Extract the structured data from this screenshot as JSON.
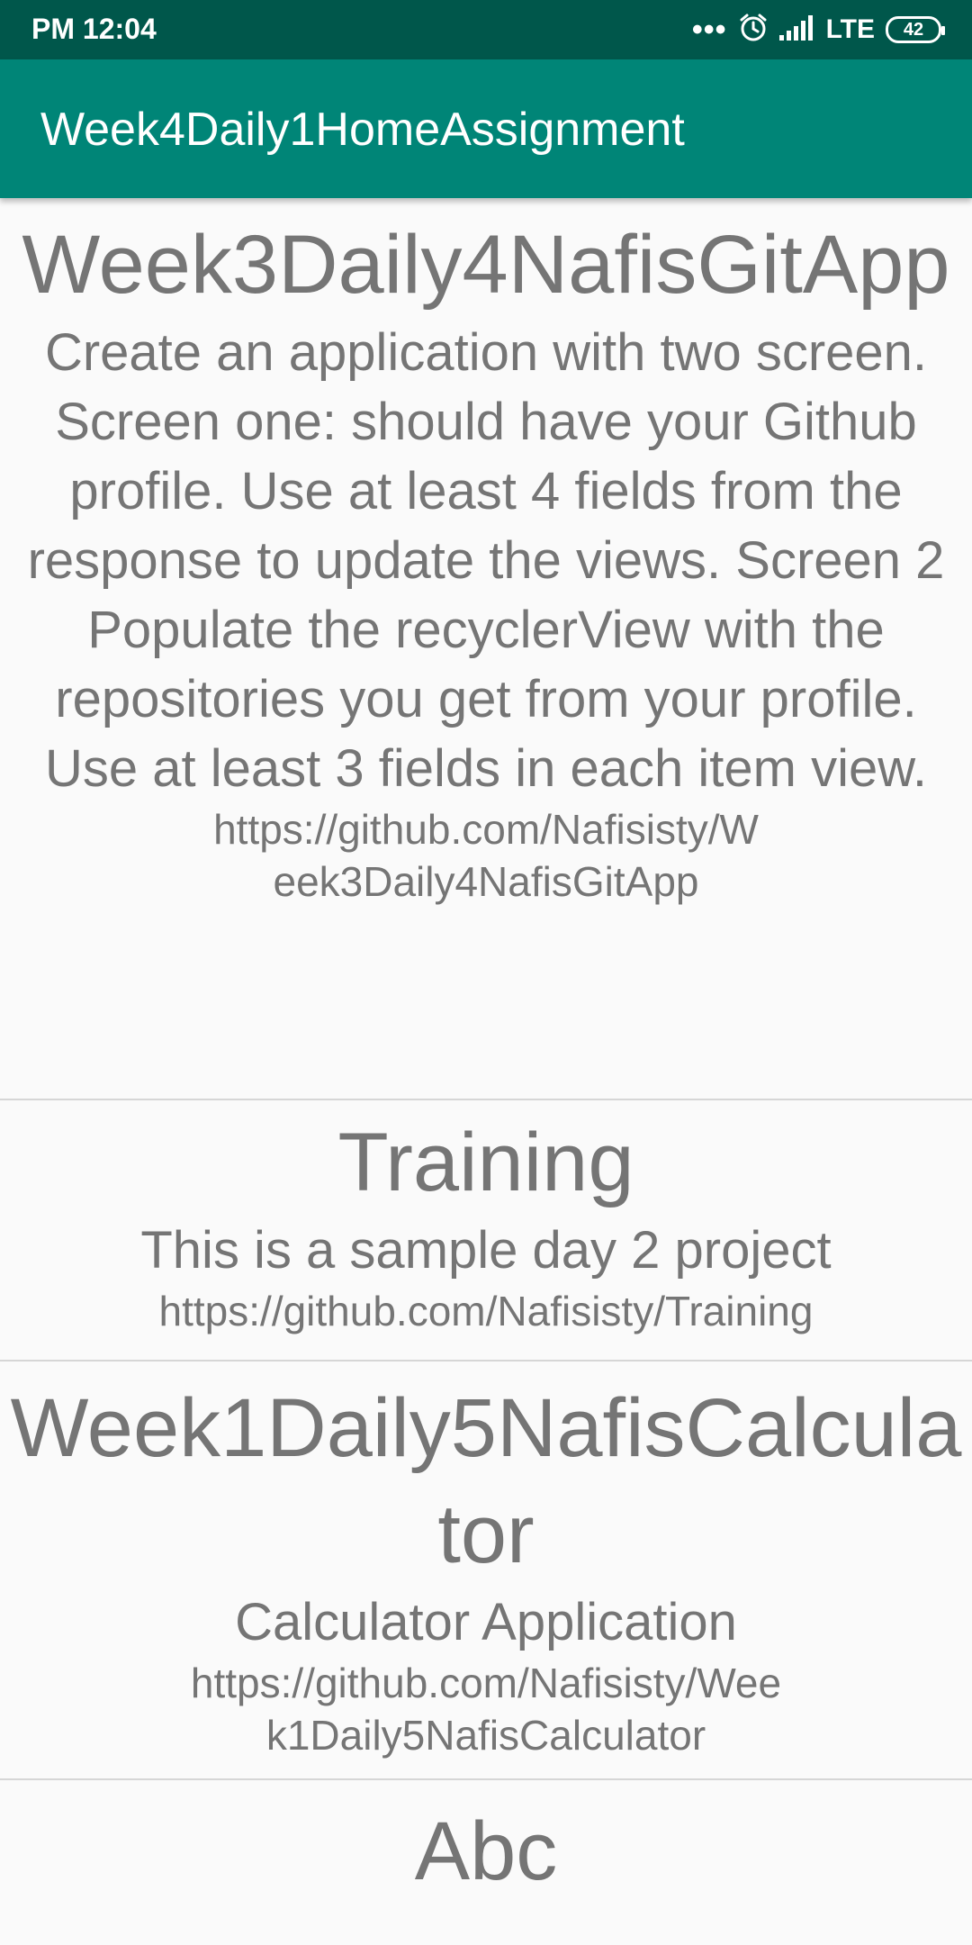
{
  "status_bar": {
    "time": "PM 12:04",
    "network": "LTE",
    "battery": "42"
  },
  "app_bar": {
    "title": "Week4Daily1HomeAssignment"
  },
  "repos": [
    {
      "name": "Week3Daily4NafisGitApp",
      "description": "Create an application with two screen. Screen one: should have your Github profile. Use at least 4 fields from the response to update the views. Screen 2 Populate the recyclerView with the repositories you get from your profile. Use at least 3 fields in each item view.",
      "url": "https://github.com/Nafisisty/Week3Daily4NafisGitApp"
    },
    {
      "name": "Training",
      "description": "This is a sample day 2 project",
      "url": "https://github.com/Nafisisty/Training"
    },
    {
      "name": "Week1Daily5NafisCalculator",
      "description": "Calculator Application",
      "url": "https://github.com/Nafisisty/Week1Daily5NafisCalculator"
    },
    {
      "name": "Abc",
      "description": "",
      "url": ""
    }
  ]
}
